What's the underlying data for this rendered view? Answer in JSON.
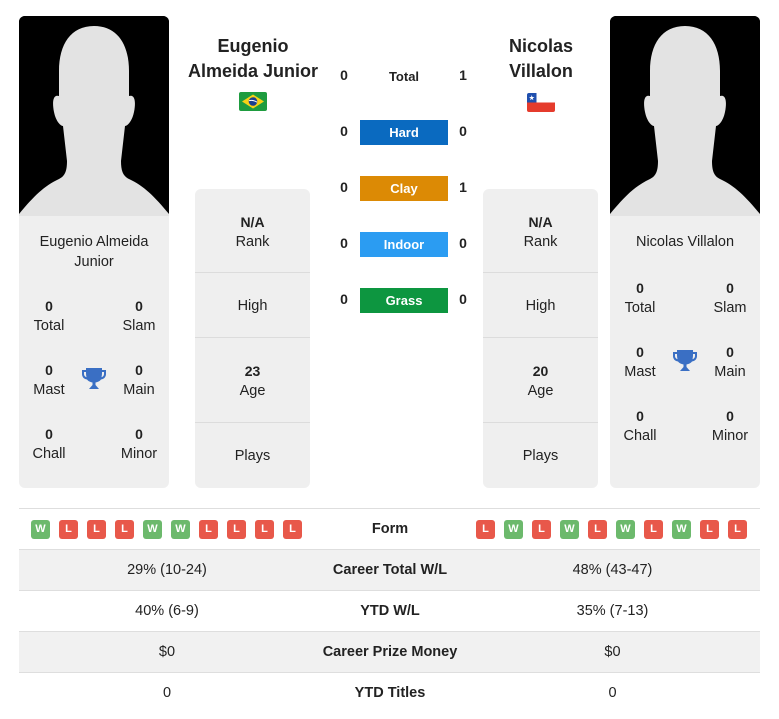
{
  "player1": {
    "header_name": "Eugenio Almeida Junior",
    "header_name_line1": "Eugenio",
    "header_name_line2": "Almeida Junior",
    "flag_icon": "brazil-flag-icon",
    "card_name_line1": "Eugenio Almeida",
    "card_name_line2": "Junior",
    "titles": {
      "total": {
        "value": "0",
        "label": "Total"
      },
      "slam": {
        "value": "0",
        "label": "Slam"
      },
      "mast": {
        "value": "0",
        "label": "Mast"
      },
      "main": {
        "value": "0",
        "label": "Main"
      },
      "chall": {
        "value": "0",
        "label": "Chall"
      },
      "minor": {
        "value": "0",
        "label": "Minor"
      }
    },
    "info": {
      "rank_value": "N/A",
      "rank_label": "Rank",
      "high_label": "High",
      "age_value": "23",
      "age_label": "Age",
      "plays_label": "Plays"
    },
    "form": [
      "W",
      "L",
      "L",
      "L",
      "W",
      "W",
      "L",
      "L",
      "L",
      "L"
    ],
    "career_total_wl": "29% (10-24)",
    "ytd_wl": "40% (6-9)",
    "career_prize_money": "$0",
    "ytd_titles": "0"
  },
  "player2": {
    "header_name": "Nicolas Villalon",
    "header_name_line1": "Nicolas",
    "header_name_line2": "Villalon",
    "flag_icon": "chile-flag-icon",
    "card_name_line1": "Nicolas Villalon",
    "titles": {
      "total": {
        "value": "0",
        "label": "Total"
      },
      "slam": {
        "value": "0",
        "label": "Slam"
      },
      "mast": {
        "value": "0",
        "label": "Mast"
      },
      "main": {
        "value": "0",
        "label": "Main"
      },
      "chall": {
        "value": "0",
        "label": "Chall"
      },
      "minor": {
        "value": "0",
        "label": "Minor"
      }
    },
    "info": {
      "rank_value": "N/A",
      "rank_label": "Rank",
      "high_label": "High",
      "age_value": "20",
      "age_label": "Age",
      "plays_label": "Plays"
    },
    "form": [
      "L",
      "W",
      "L",
      "W",
      "L",
      "W",
      "L",
      "W",
      "L",
      "L"
    ],
    "career_total_wl": "48% (43-47)",
    "ytd_wl": "35% (7-13)",
    "career_prize_money": "$0",
    "ytd_titles": "0"
  },
  "h2h": {
    "total": {
      "label": "Total",
      "p1": "0",
      "p2": "1"
    },
    "surfaces": [
      {
        "label": "Hard",
        "p1": "0",
        "p2": "0",
        "color": "#0a6ac0"
      },
      {
        "label": "Clay",
        "p1": "0",
        "p2": "1",
        "color": "#dc8a05"
      },
      {
        "label": "Indoor",
        "p1": "0",
        "p2": "0",
        "color": "#2b9cf2"
      },
      {
        "label": "Grass",
        "p1": "0",
        "p2": "0",
        "color": "#0d9640"
      }
    ]
  },
  "table": {
    "form_label": "Form",
    "career_total_label": "Career Total W/L",
    "ytd_wl_label": "YTD W/L",
    "prize_label": "Career Prize Money",
    "ytd_titles_label": "YTD Titles"
  },
  "colors": {
    "win": "#6cb96c",
    "loss": "#e8584a",
    "trophy": "#3a6fc4"
  }
}
